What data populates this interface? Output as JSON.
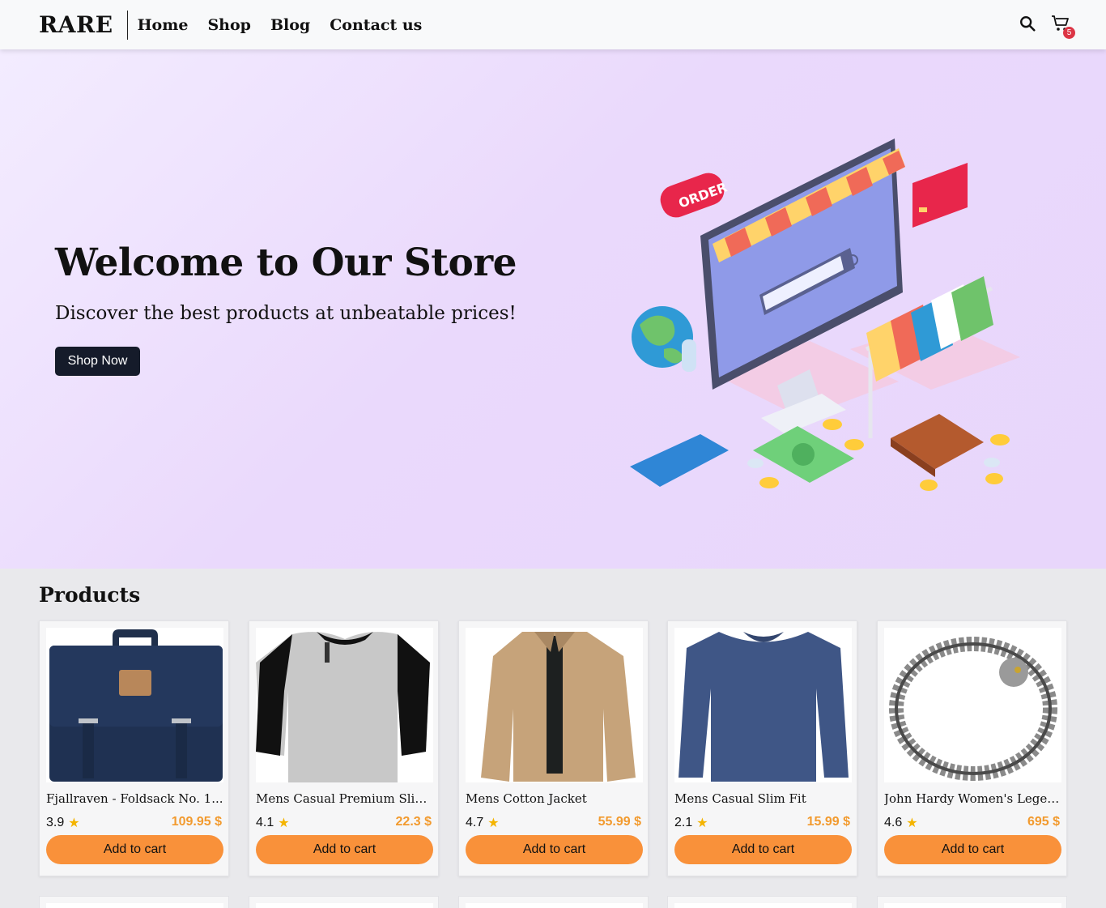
{
  "nav": {
    "brand": "RARE",
    "links": [
      "Home",
      "Shop",
      "Blog",
      "Contact us"
    ],
    "search_icon": "search-icon",
    "cart_icon": "cart-icon",
    "cart_count": "5"
  },
  "hero": {
    "title": "Welcome to Our Store",
    "subtitle": "Discover the best products at unbeatable prices!",
    "cta": "Shop Now",
    "illustration": "online-shopping-illustration",
    "order_tag": "ORDER"
  },
  "products": {
    "heading": "Products",
    "add_label": "Add to cart",
    "items": [
      {
        "title": "Fjallraven - Foldsack No. 1...",
        "rating": "3.9",
        "price": "109.95 $",
        "image": "backpack-image"
      },
      {
        "title": "Mens Casual Premium Slim...",
        "rating": "4.1",
        "price": "22.3 $",
        "image": "raglan-tshirt-image"
      },
      {
        "title": "Mens Cotton Jacket",
        "rating": "4.7",
        "price": "55.99 $",
        "image": "cotton-jacket-image"
      },
      {
        "title": "Mens Casual Slim Fit",
        "rating": "2.1",
        "price": "15.99 $",
        "image": "longsleeve-shirt-image"
      },
      {
        "title": "John Hardy Women's Legen...",
        "rating": "4.6",
        "price": "695 $",
        "image": "bracelet-image"
      }
    ]
  },
  "colors": {
    "accent": "#f9913a",
    "price": "#f29a2e",
    "badge": "#dc3545",
    "dark_button": "#151b2a",
    "hero_bg": "#ead9fc"
  }
}
